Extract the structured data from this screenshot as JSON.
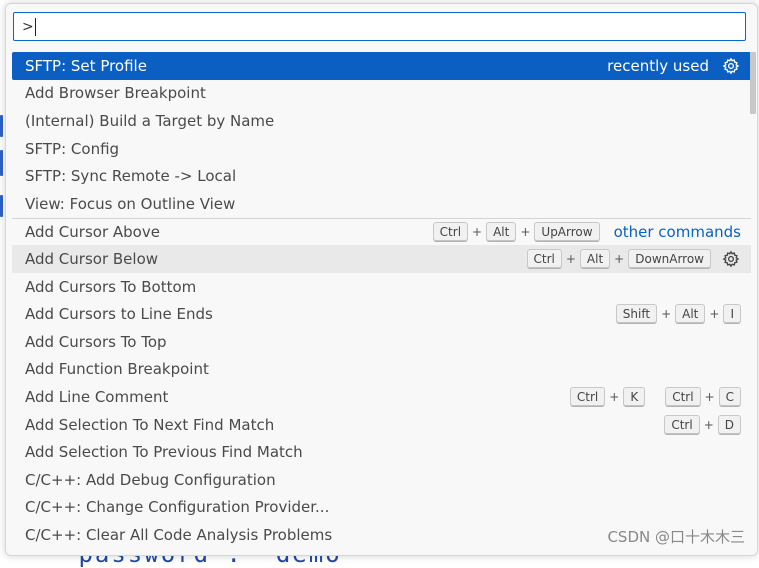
{
  "palette": {
    "input_value": ">",
    "items": [
      {
        "label": "SFTP: Set Profile",
        "badge": "recently used",
        "gear": true,
        "selected": true
      },
      {
        "label": "Add Browser Breakpoint"
      },
      {
        "label": "(Internal) Build a Target by Name"
      },
      {
        "label": "SFTP: Config"
      },
      {
        "label": "SFTP: Sync Remote -> Local"
      },
      {
        "label": "View: Focus on Outline View"
      },
      {
        "label": "Add Cursor Above",
        "separator": true,
        "group": "other commands",
        "keys": [
          [
            "Ctrl",
            "Alt",
            "UpArrow"
          ]
        ]
      },
      {
        "label": "Add Cursor Below",
        "hover": true,
        "gear": true,
        "keys": [
          [
            "Ctrl",
            "Alt",
            "DownArrow"
          ]
        ]
      },
      {
        "label": "Add Cursors To Bottom"
      },
      {
        "label": "Add Cursors to Line Ends",
        "keys": [
          [
            "Shift",
            "Alt",
            "I"
          ]
        ]
      },
      {
        "label": "Add Cursors To Top"
      },
      {
        "label": "Add Function Breakpoint"
      },
      {
        "label": "Add Line Comment",
        "keys": [
          [
            "Ctrl",
            "K"
          ],
          [
            "Ctrl",
            "C"
          ]
        ]
      },
      {
        "label": "Add Selection To Next Find Match",
        "keys": [
          [
            "Ctrl",
            "D"
          ]
        ]
      },
      {
        "label": "Add Selection To Previous Find Match"
      },
      {
        "label": "C/C++: Add Debug Configuration"
      },
      {
        "label": "C/C++: Change Configuration Provider..."
      },
      {
        "label": "C/C++: Clear All Code Analysis Problems"
      }
    ]
  },
  "editor": {
    "code_fragment": "\"password\": \"demo\""
  },
  "watermark": "CSDN @口十木木三",
  "colors": {
    "accent": "#0b5fc2",
    "link": "#0a62c4"
  },
  "icons": {
    "gear": "gear-icon"
  }
}
